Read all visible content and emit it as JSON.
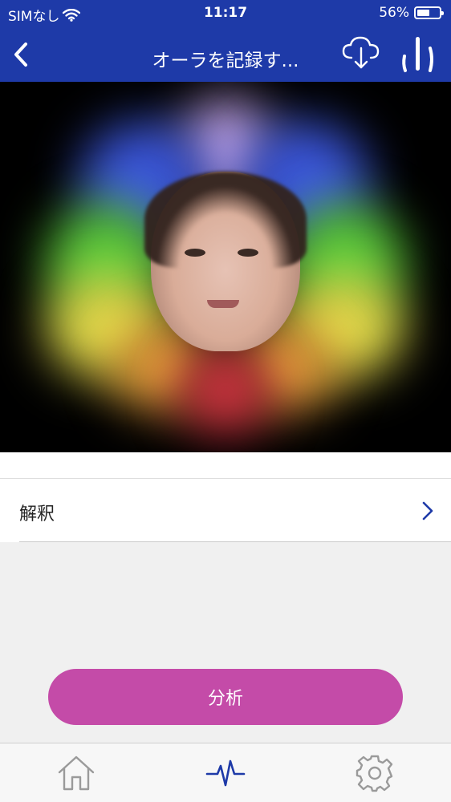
{
  "status_bar": {
    "carrier": "SIMなし",
    "time": "11:17",
    "battery_percent": "56%",
    "battery_level": 0.56
  },
  "nav": {
    "title": "オーラを記録す...",
    "back_icon": "chevron-left-icon",
    "download_icon": "cloud-download-icon",
    "chart_icon": "bars-icon"
  },
  "aura_image": {
    "colors": {
      "violet": "#b79bdc",
      "blue": "#3a55d8",
      "green": "#58c83b",
      "yellow": "#e0d84a",
      "orange": "#e39b3a",
      "red": "#c8323e"
    }
  },
  "list": {
    "interpretation_label": "解釈"
  },
  "actions": {
    "analyze_label": "分析"
  },
  "tabbar": {
    "tabs": [
      {
        "name": "home",
        "icon": "home-icon",
        "active": false
      },
      {
        "name": "pulse",
        "icon": "pulse-icon",
        "active": true
      },
      {
        "name": "settings",
        "icon": "gear-icon",
        "active": false
      }
    ],
    "active_color": "#1e3aa8",
    "inactive_color": "#9a9a9a"
  },
  "theme": {
    "primary": "#1e3aa8",
    "accent": "#c44ba8"
  }
}
